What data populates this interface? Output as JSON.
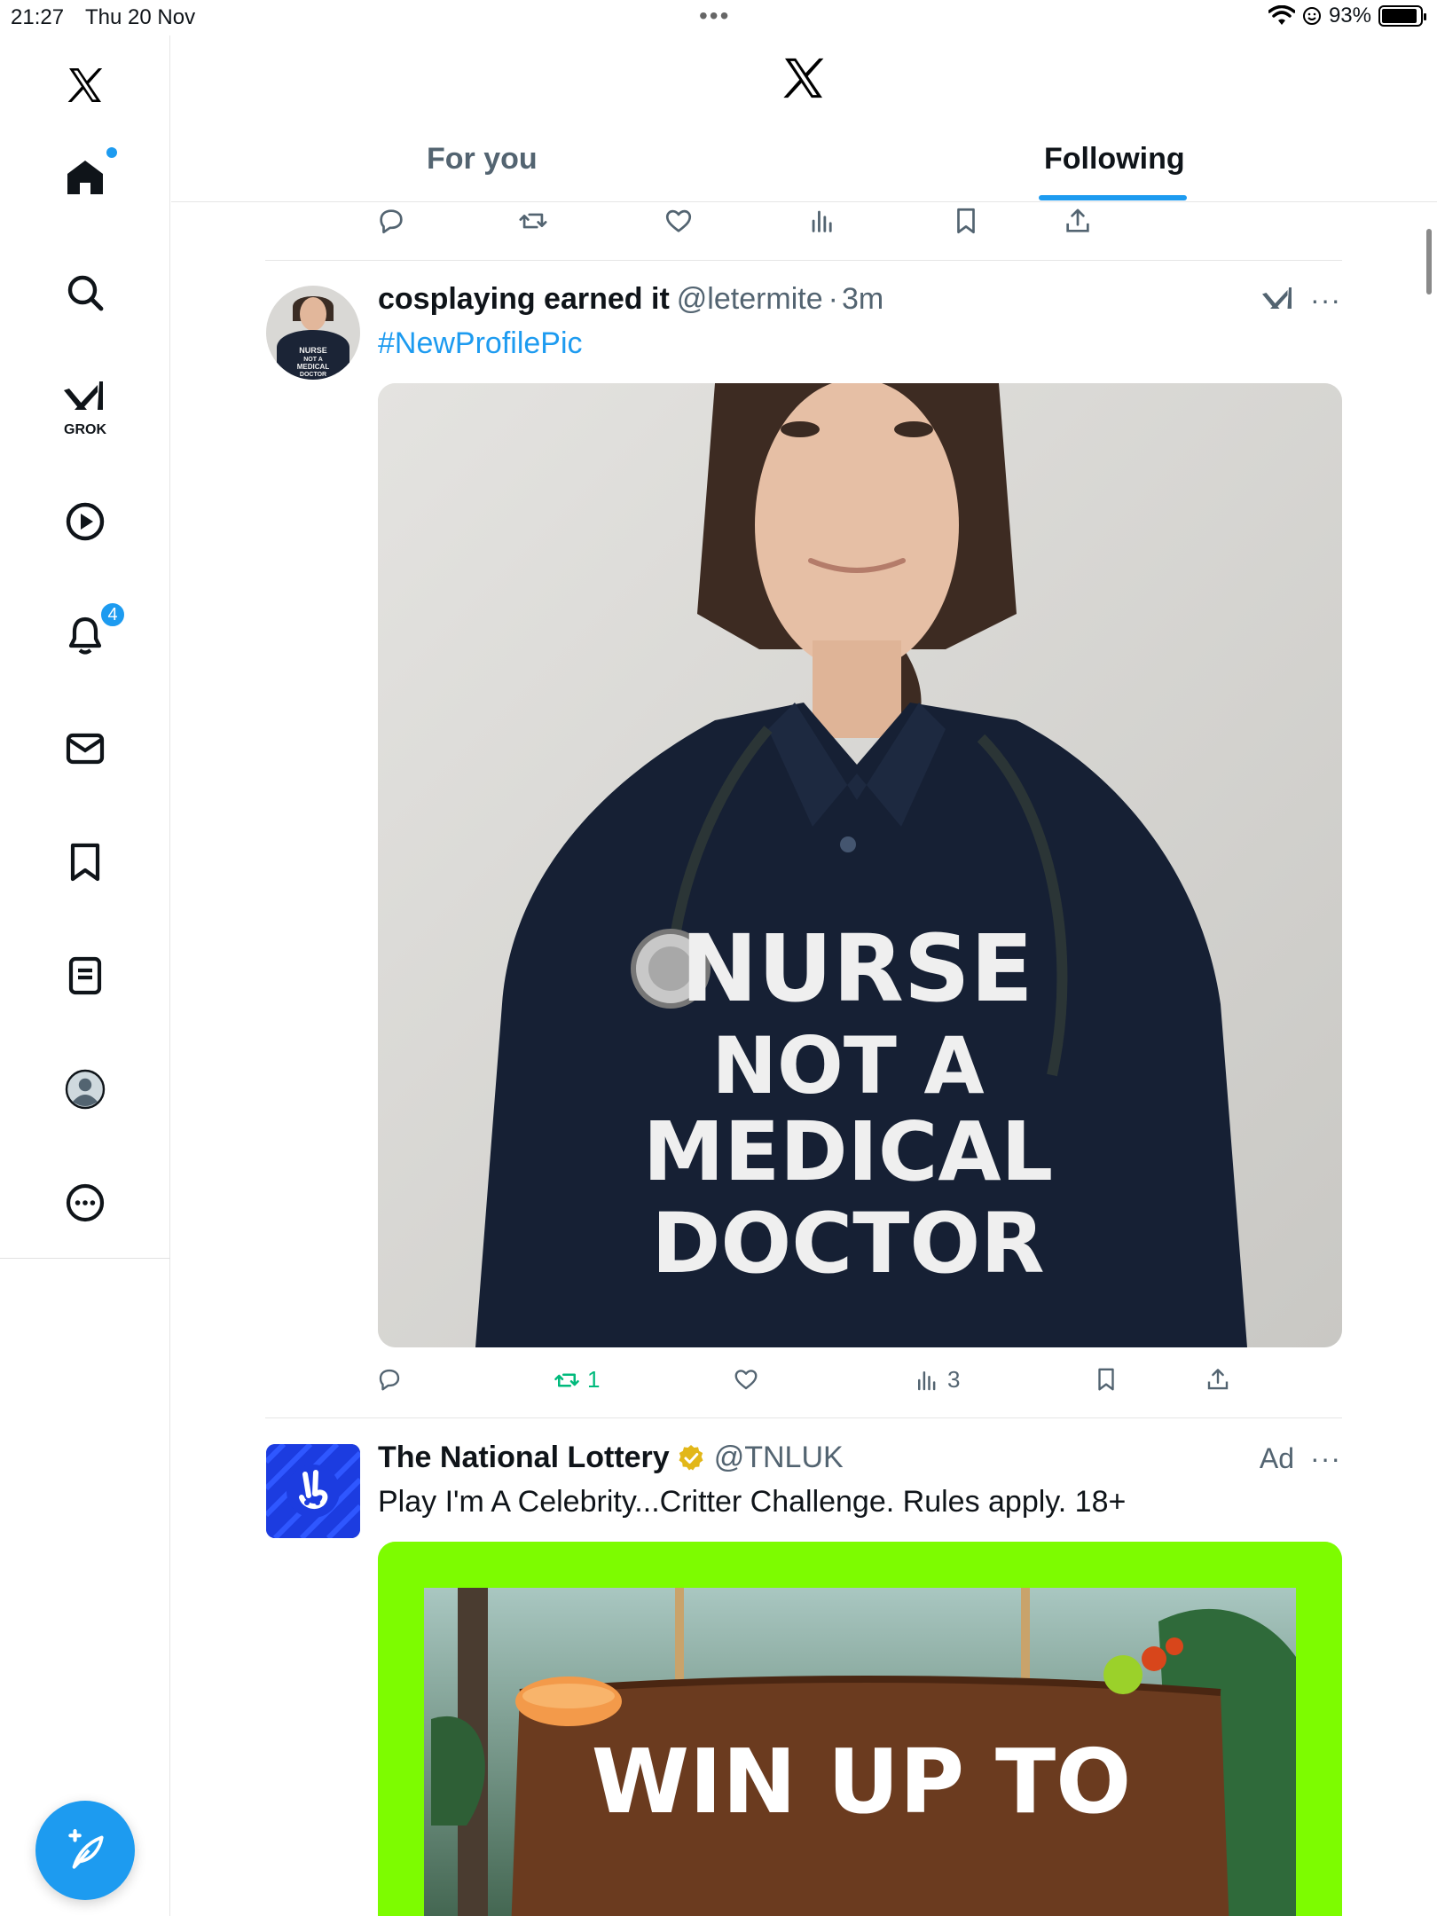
{
  "status_bar": {
    "time": "21:27",
    "date": "Thu 20 Nov",
    "battery": "93%",
    "battery_level": 0.93
  },
  "sidebar": {
    "items": [
      {
        "name": "home",
        "icon": "home-icon",
        "badge": ""
      },
      {
        "name": "search",
        "icon": "search-icon",
        "badge": ""
      },
      {
        "name": "grok",
        "icon": "grok-icon",
        "label": "GROK"
      },
      {
        "name": "video",
        "icon": "play-icon",
        "badge": ""
      },
      {
        "name": "notifications",
        "icon": "bell-icon",
        "badge": "4"
      },
      {
        "name": "messages",
        "icon": "envelope-icon",
        "badge": ""
      },
      {
        "name": "bookmarks",
        "icon": "bookmark-icon",
        "badge": ""
      },
      {
        "name": "lists",
        "icon": "document-icon",
        "badge": ""
      },
      {
        "name": "profile",
        "icon": "avatar-icon",
        "badge": ""
      },
      {
        "name": "more",
        "icon": "more-circle-icon",
        "badge": ""
      }
    ]
  },
  "header": {
    "tabs": [
      {
        "label": "For you",
        "active": false
      },
      {
        "label": "Following",
        "active": true
      }
    ]
  },
  "posts": [
    {
      "name": "cosplaying earned it",
      "handle": "@letermite",
      "time": "3m",
      "text": "#NewProfilePic",
      "avatar_text": [
        "NURSE",
        "NOT A",
        "MEDICAL",
        "DOCTOR"
      ],
      "image_text": [
        "NURSE",
        "NOT A",
        "MEDICAL",
        "DOCTOR"
      ],
      "stats": {
        "reposts": "1",
        "views": "3"
      }
    },
    {
      "name": "The National Lottery",
      "handle": "@TNLUK",
      "ad_label": "Ad",
      "text": "Play I'm A Celebrity...Critter Challenge. Rules apply. 18+",
      "image_text": "WIN UP TO"
    }
  ],
  "colors": {
    "accent": "#1d9bf0",
    "text": "#0f1419",
    "muted": "#536471",
    "repost_green": "#00ba7c",
    "verified_gold": "#e2b719",
    "lottery_blue": "#1c3ce0",
    "ad_green": "#7dfc00"
  }
}
